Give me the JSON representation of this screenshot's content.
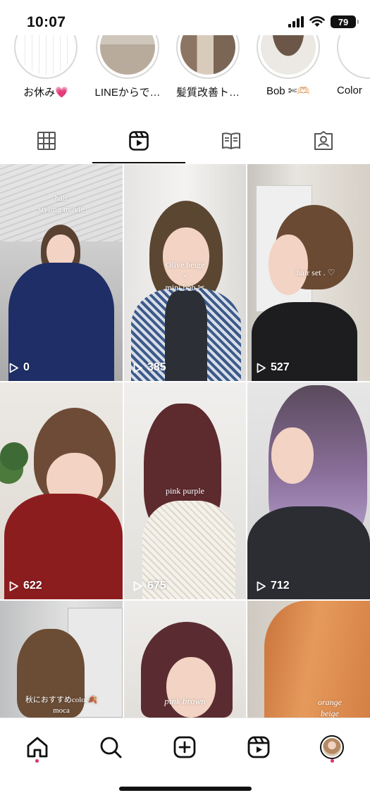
{
  "status_bar": {
    "time": "10:07",
    "battery": "79"
  },
  "highlights": [
    {
      "label": "お休み💗"
    },
    {
      "label": "LINEからで…"
    },
    {
      "label": "髪質改善ト…"
    },
    {
      "label": "Bob ✄🫶🏻"
    },
    {
      "label": "Color"
    }
  ],
  "tabs": [
    {
      "icon": "grid-icon"
    },
    {
      "icon": "reels-icon"
    },
    {
      "icon": "guide-icon"
    },
    {
      "icon": "tagged-icon"
    }
  ],
  "reels": [
    {
      "caption": "hair\nstyling movie",
      "views": "0"
    },
    {
      "caption": "Olive beige\n×\nmini bob ✂",
      "views": "385"
    },
    {
      "caption": "hair set . ♡",
      "views": "527"
    },
    {
      "caption": "",
      "views": "622"
    },
    {
      "caption": "pink purple",
      "views": "675"
    },
    {
      "caption": "",
      "views": "712"
    },
    {
      "caption": "秋におすすめcolor🍂\nmoca",
      "views": ""
    },
    {
      "caption": "pink brown",
      "views": ""
    },
    {
      "caption": "orange\nbeige",
      "views": ""
    }
  ],
  "bottom_nav": [
    {
      "icon": "home-icon"
    },
    {
      "icon": "search-icon"
    },
    {
      "icon": "create-icon"
    },
    {
      "icon": "reels-nav-icon"
    },
    {
      "icon": "profile-avatar"
    }
  ],
  "colors": {
    "notification_dot": "#e1306c",
    "active_tab": "#111111"
  }
}
